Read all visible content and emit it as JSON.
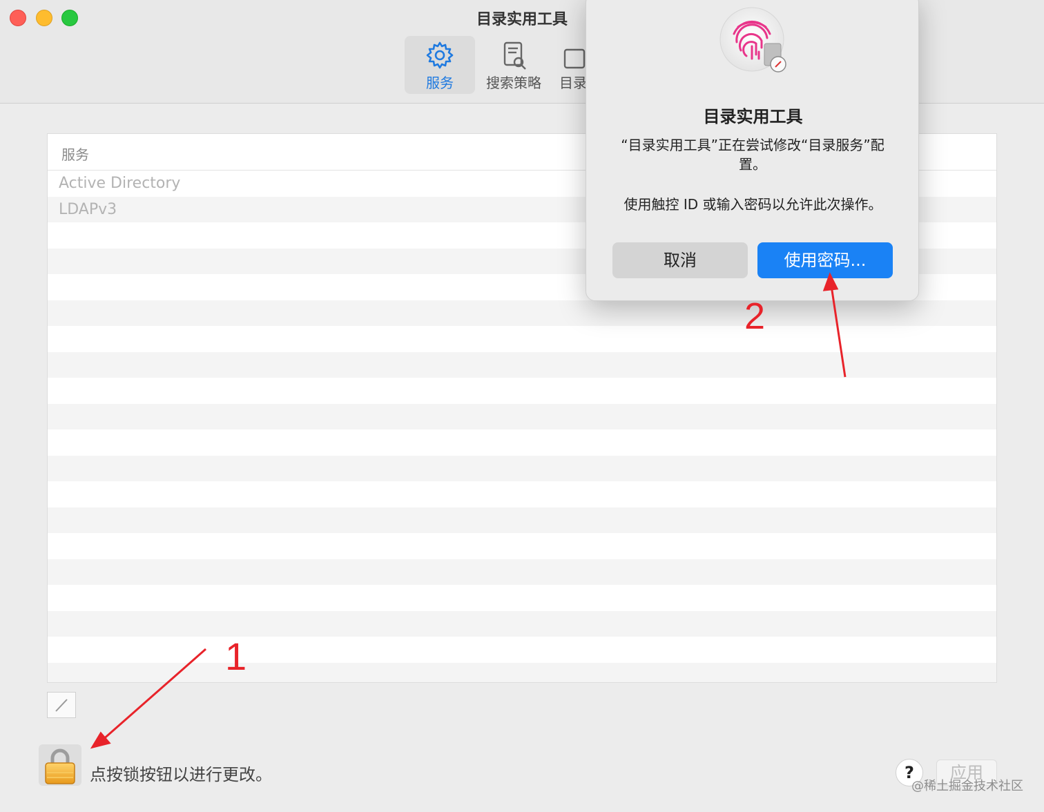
{
  "window": {
    "title": "目录实用工具"
  },
  "toolbar": {
    "items": [
      {
        "label": "服务",
        "icon": "gear-icon",
        "active": true
      },
      {
        "label": "搜索策略",
        "icon": "search-document-icon",
        "active": false
      },
      {
        "label": "目录",
        "icon": "directory-icon",
        "active": false
      }
    ]
  },
  "services": {
    "header": "服务",
    "rows": [
      "Active Directory",
      "LDAPv3"
    ]
  },
  "bottom": {
    "lock_text": "点按锁按钮以进行更改。",
    "help_label": "?",
    "apply_label": "应用"
  },
  "dialog": {
    "title": "目录实用工具",
    "message": "“目录实用工具”正在尝试修改“目录服务”配置。",
    "instruction": "使用触控 ID 或输入密码以允许此次操作。",
    "cancel_label": "取消",
    "password_label": "使用密码...",
    "icon": "touch-id-fingerprint-icon"
  },
  "annotations": {
    "label_1": "1",
    "label_2": "2",
    "color": "#e8232a"
  },
  "watermark": "@稀土掘金技术社区",
  "colors": {
    "accent": "#1a82f5",
    "close": "#fe5f57",
    "minimize": "#febc2e",
    "maximize": "#28c840"
  }
}
